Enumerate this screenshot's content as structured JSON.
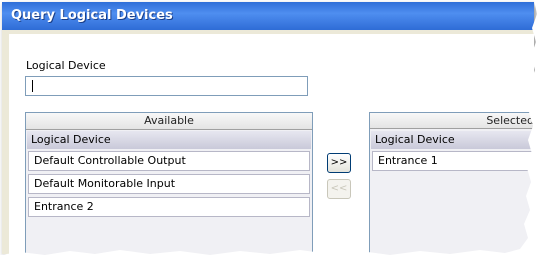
{
  "window": {
    "title": "Query Logical Devices"
  },
  "filter": {
    "label": "Logical Device",
    "value": ""
  },
  "available": {
    "header": "Available",
    "column": "Logical Device",
    "items": [
      "Default Controllable Output",
      "Default Monitorable Input",
      "Entrance 2"
    ]
  },
  "selected": {
    "header": "Selected",
    "column": "Logical Device",
    "items": [
      "Entrance 1"
    ]
  },
  "buttons": {
    "add": ">>",
    "remove": "<<"
  }
}
